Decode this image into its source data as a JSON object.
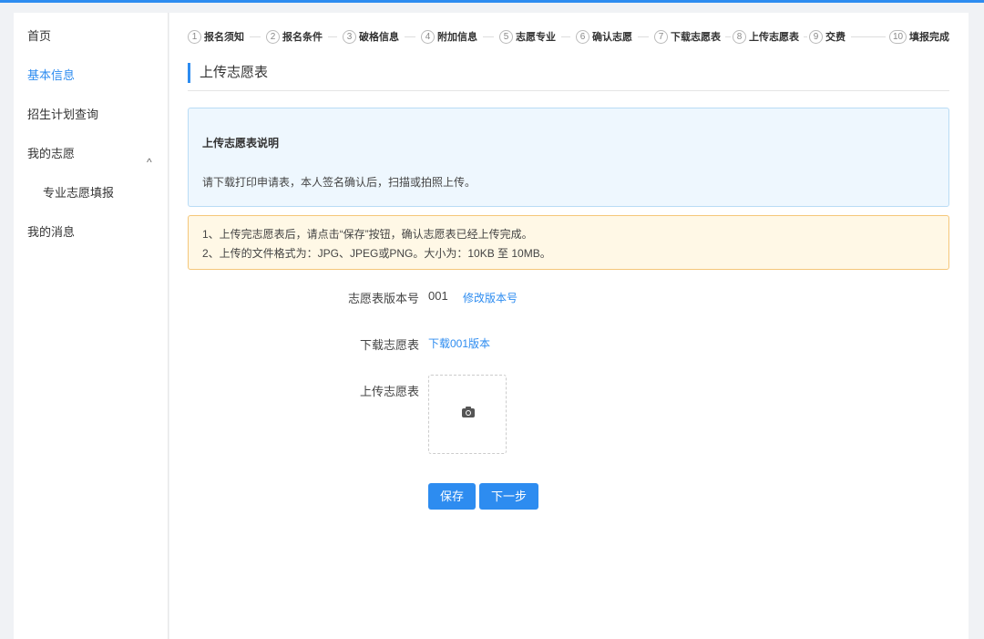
{
  "sidebar": {
    "items": [
      {
        "label": "首页"
      },
      {
        "label": "基本信息"
      },
      {
        "label": "招生计划查询"
      },
      {
        "label": "我的志愿"
      },
      {
        "label": "专业志愿填报"
      },
      {
        "label": "我的消息"
      }
    ],
    "chevron": "^"
  },
  "steps": [
    {
      "num": "1",
      "label": "报名须知"
    },
    {
      "num": "2",
      "label": "报名条件"
    },
    {
      "num": "3",
      "label": "破格信息"
    },
    {
      "num": "4",
      "label": "附加信息"
    },
    {
      "num": "5",
      "label": "志愿专业"
    },
    {
      "num": "6",
      "label": "确认志愿"
    },
    {
      "num": "7",
      "label": "下载志愿表"
    },
    {
      "num": "8",
      "label": "上传志愿表"
    },
    {
      "num": "9",
      "label": "交费"
    },
    {
      "num": "10",
      "label": "填报完成"
    }
  ],
  "page": {
    "title": "上传志愿表"
  },
  "info": {
    "title": "上传志愿表说明",
    "text": "请下载打印申请表，本人签名确认后，扫描或拍照上传。"
  },
  "notice": {
    "line1": "1、上传完志愿表后，请点击“保存”按钮，确认志愿表已经上传完成。",
    "line2": "2、上传的文件格式为：JPG、JPEG或PNG。大小为：10KB 至 10MB。"
  },
  "form": {
    "version_label": "志愿表版本号",
    "version_value": "001",
    "modify_link": "修改版本号",
    "download_label": "下载志愿表",
    "download_link": "下载001版本",
    "upload_label": "上传志愿表"
  },
  "buttons": {
    "save": "保存",
    "next": "下一步"
  },
  "colors": {
    "accent": "#2d8cf0",
    "info_bg": "#eef7fe",
    "warn_bg": "#fff8e6"
  }
}
